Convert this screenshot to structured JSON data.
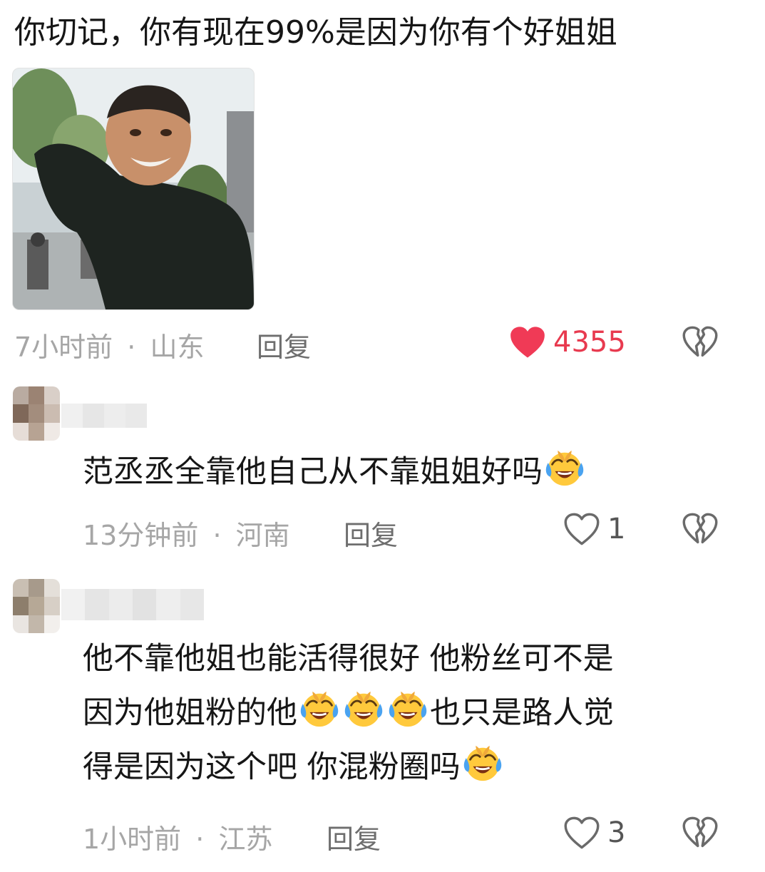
{
  "comments": [
    {
      "text": "你切记，你有现在99%是因为你有个好姐姐",
      "time": "7小时前",
      "location": "山东",
      "reply_label": "回复",
      "likes": "4355",
      "liked": true,
      "has_image": true
    },
    {
      "text": "范丞丞全靠他自己从不靠姐姐好吗",
      "emoji_count": 1,
      "time": "13分钟前",
      "location": "河南",
      "reply_label": "回复",
      "likes": "1",
      "liked": false
    },
    {
      "text_line1": "他不靠他姐也能活得很好 他粉丝可不是",
      "text_line2a": "因为他姐粉的他",
      "text_line2b": "也只是路人觉",
      "text_line3": "得是因为这个吧 你混粉圈吗",
      "time": "1小时前",
      "location": "江苏",
      "reply_label": "回复",
      "likes": "3",
      "liked": false
    }
  ],
  "separator": "·",
  "colors": {
    "like_active": "#e83a4f",
    "meta_gray": "#a6a6a6",
    "reply_gray": "#6e6e6e",
    "icon_gray": "#6a6a6a"
  },
  "icons": {
    "like_active": "heart-filled-icon",
    "like": "heart-outline-icon",
    "dislike": "broken-heart-icon",
    "emoji": "laugh-cry-emoji"
  }
}
